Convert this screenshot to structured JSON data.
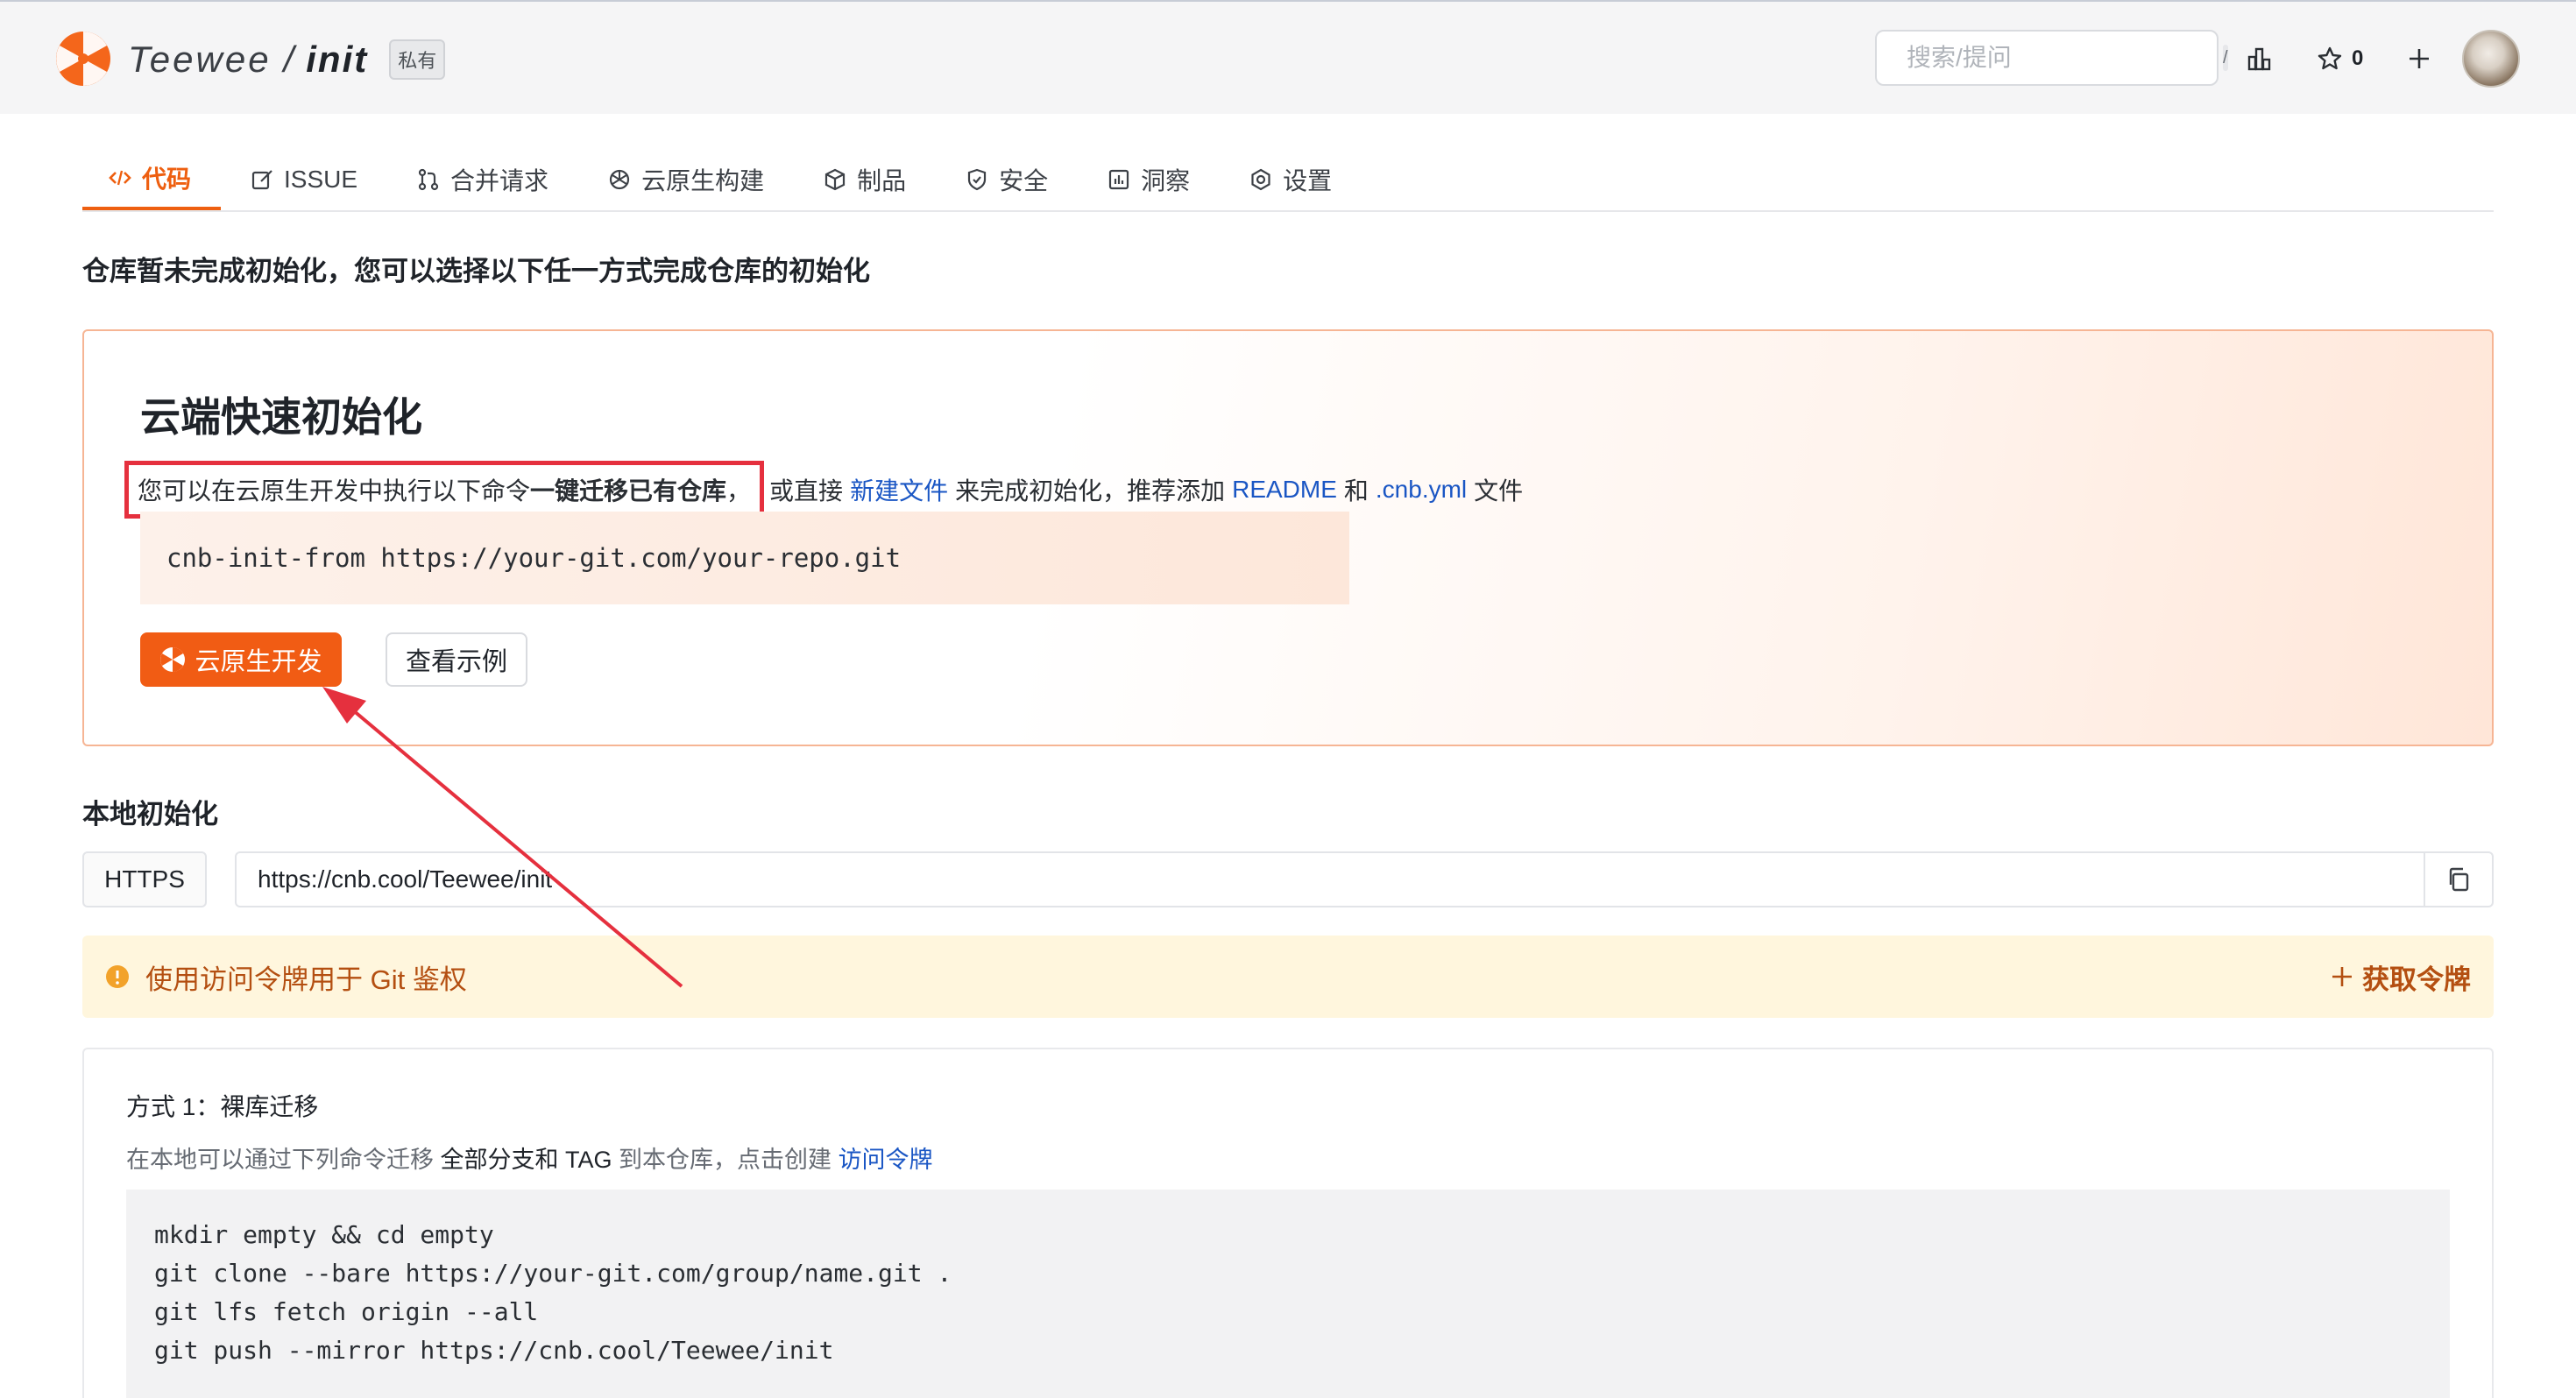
{
  "header": {
    "owner": "Teewee",
    "separator": "/",
    "repo": "init",
    "visibility_badge": "私有",
    "search_placeholder": "搜索/提问",
    "search_shortcut": "/",
    "star_count": "0",
    "icons": [
      "logo-icon",
      "search-icon",
      "stats-icon",
      "star-icon",
      "plus-icon",
      "avatar"
    ]
  },
  "tabs": [
    {
      "label": "代码",
      "icon": "code-icon",
      "active": true
    },
    {
      "label": "ISSUE",
      "icon": "issue-icon"
    },
    {
      "label": "合并请求",
      "icon": "merge-request-icon"
    },
    {
      "label": "云原生构建",
      "icon": "build-icon"
    },
    {
      "label": "制品",
      "icon": "package-icon"
    },
    {
      "label": "安全",
      "icon": "shield-icon"
    },
    {
      "label": "洞察",
      "icon": "insight-icon"
    },
    {
      "label": "设置",
      "icon": "gear-icon"
    }
  ],
  "notice": "仓库暂未完成初始化，您可以选择以下任一方式完成仓库的初始化",
  "cloud_init": {
    "title": "云端快速初始化",
    "desc_prefix": "您可以在云原生开发中执行以下命令",
    "desc_bold": "一键迁移已有仓库",
    "desc_comma": "，",
    "desc_mid": "或直接",
    "link_new_file": "新建文件",
    "desc_mid2": "来完成初始化，推荐添加",
    "link_readme": "README",
    "desc_and": "和",
    "link_cnb_yml": ".cnb.yml",
    "desc_suffix": "文件",
    "command": "cnb-init-from https://your-git.com/your-repo.git",
    "primary_button": "云原生开发",
    "secondary_button": "查看示例",
    "accent_color": "#f15c14"
  },
  "local_init": {
    "title": "本地初始化",
    "protocol": "HTTPS",
    "clone_url": "https://cnb.cool/Teewee/init",
    "token_notice": "使用访问令牌用于 Git 鉴权",
    "token_action": "获取令牌",
    "method": {
      "title": "方式 1：裸库迁移",
      "desc_prefix": "在本地可以通过下列命令迁移",
      "desc_bold": "全部分支和 TAG",
      "desc_mid": "到本仓库，点击创建",
      "desc_link": "访问令牌",
      "commands": [
        "mkdir empty && cd empty",
        "git clone --bare https://your-git.com/group/name.git .",
        "git lfs fetch origin --all",
        "git push --mirror https://cnb.cool/Teewee/init"
      ]
    }
  },
  "annotation": {
    "highlight_color": "#e5303e"
  }
}
